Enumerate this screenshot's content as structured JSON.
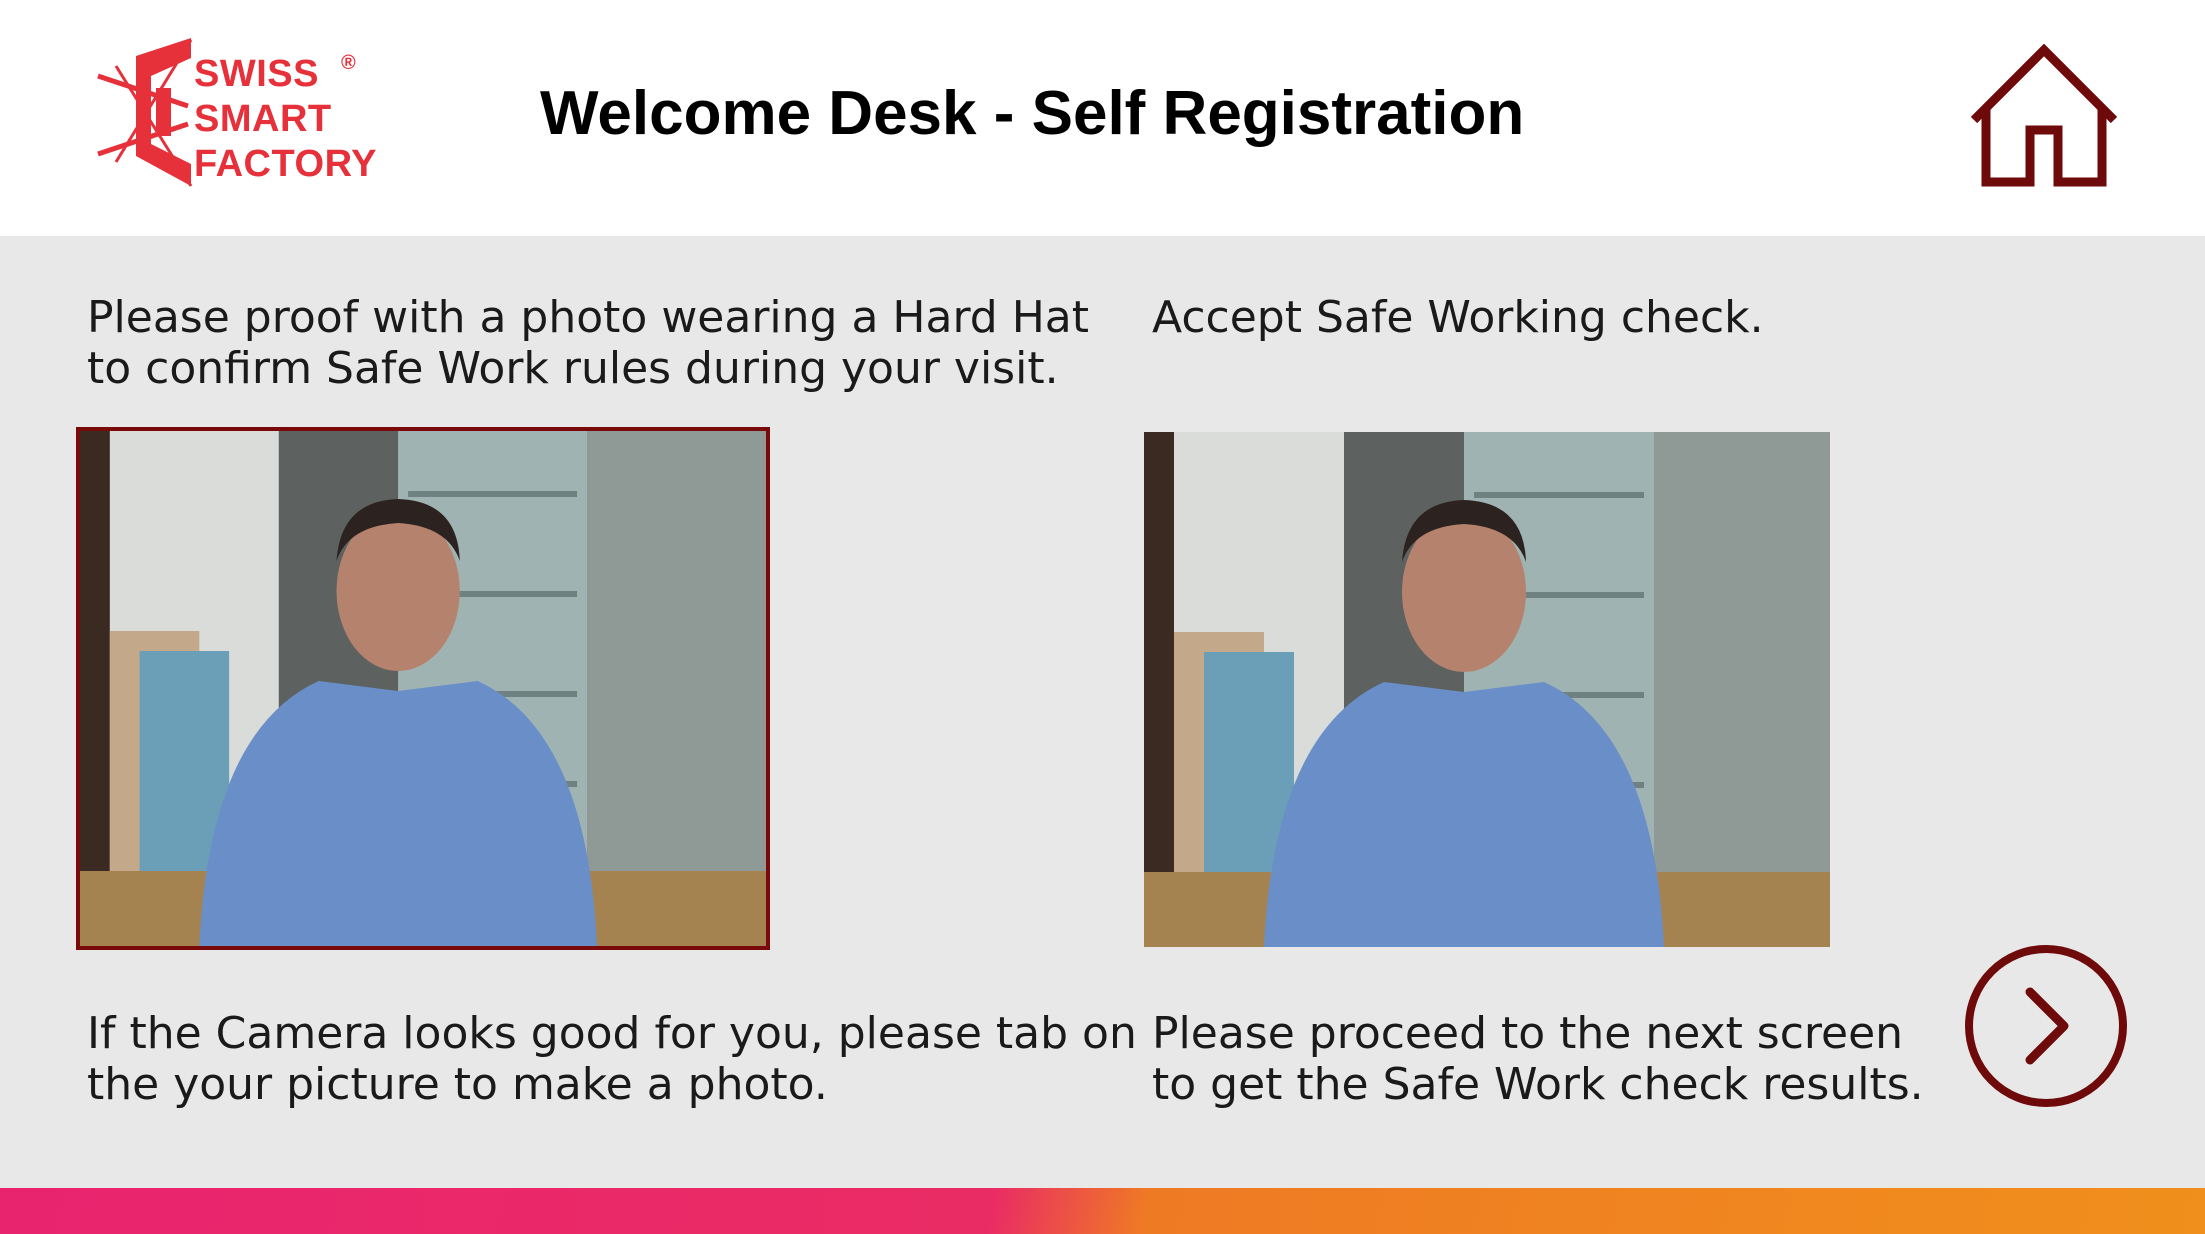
{
  "logo": {
    "lines": [
      "SWISS",
      "SMART",
      "FACTORY"
    ],
    "registered_mark": "®"
  },
  "header": {
    "title": "Welcome Desk - Self Registration",
    "home_icon": "home-icon"
  },
  "left_panel": {
    "instruction_lines": [
      "Please proof with a photo wearing a Hard Hat",
      "to confirm Safe Work rules during your visit."
    ],
    "hint_lines": [
      "If the Camera looks good for you, please tab on",
      "the your picture to make a photo."
    ]
  },
  "right_panel": {
    "instruction_lines": [
      "Accept Safe Working check."
    ],
    "hint_lines": [
      "Please proceed to the next screen",
      "to get the Safe Work check results."
    ]
  },
  "navigation": {
    "next_icon": "chevron-right-circle-icon"
  },
  "colors": {
    "brand_red": "#e6303a",
    "accent_dark_red": "#6e0a0a",
    "background": "#e8e8e8",
    "bar_pink": "#e9246f",
    "bar_orange": "#f08f1c"
  }
}
